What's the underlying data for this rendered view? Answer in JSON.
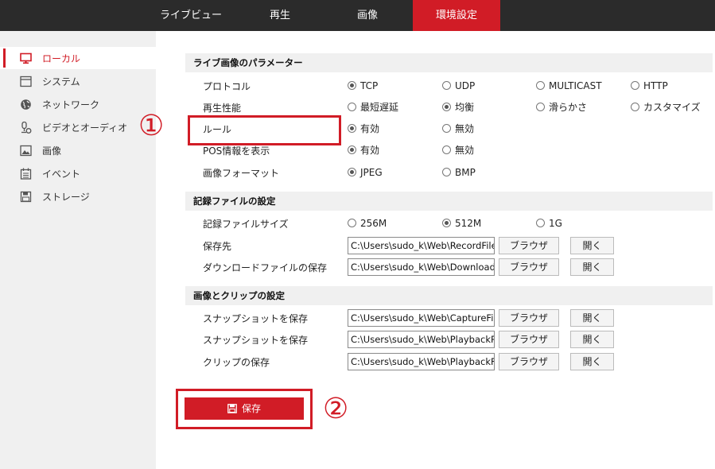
{
  "topnav": {
    "tabs": [
      {
        "label": "ライブビュー"
      },
      {
        "label": "再生"
      },
      {
        "label": "画像"
      },
      {
        "label": "環境設定",
        "active": true
      }
    ]
  },
  "sidebar": {
    "items": [
      {
        "label": "ローカル",
        "icon": "monitor-icon",
        "active": true
      },
      {
        "label": "システム",
        "icon": "system-window-icon"
      },
      {
        "label": "ネットワーク",
        "icon": "globe-icon"
      },
      {
        "label": "ビデオとオーディオ",
        "icon": "video-audio-icon"
      },
      {
        "label": "画像",
        "icon": "image-icon"
      },
      {
        "label": "イベント",
        "icon": "calendar-icon"
      },
      {
        "label": "ストレージ",
        "icon": "floppy-icon"
      }
    ]
  },
  "live_params": {
    "title": "ライブ画像のパラメーター",
    "rows": [
      {
        "label": "プロトコル",
        "options": [
          "TCP",
          "UDP",
          "MULTICAST",
          "HTTP"
        ],
        "selected": "TCP"
      },
      {
        "label": "再生性能",
        "options": [
          "最短遅延",
          "均衡",
          "滑らかさ",
          "カスタマイズ"
        ],
        "selected": "均衡"
      },
      {
        "label": "ルール",
        "options": [
          "有効",
          "無効"
        ],
        "selected": "有効"
      },
      {
        "label": "POS情報を表示",
        "options": [
          "有効",
          "無効"
        ],
        "selected": "有効"
      },
      {
        "label": "画像フォーマット",
        "options": [
          "JPEG",
          "BMP"
        ],
        "selected": "JPEG"
      }
    ]
  },
  "record_settings": {
    "title": "記録ファイルの設定",
    "size_row": {
      "label": "記録ファイルサイズ",
      "options": [
        "256M",
        "512M",
        "1G"
      ],
      "selected": "512M"
    },
    "path_rows": [
      {
        "label": "保存先",
        "value": "C:\\Users\\sudo_k\\Web\\RecordFiles",
        "browse": "ブラウザ",
        "open": "開く"
      },
      {
        "label": "ダウンロードファイルの保存",
        "value": "C:\\Users\\sudo_k\\Web\\DownloadFiles",
        "browse": "ブラウザ",
        "open": "開く"
      }
    ]
  },
  "clip_settings": {
    "title": "画像とクリップの設定",
    "path_rows": [
      {
        "label": "スナップショットを保存",
        "value": "C:\\Users\\sudo_k\\Web\\CaptureFiles",
        "browse": "ブラウザ",
        "open": "開く"
      },
      {
        "label": "スナップショットを保存",
        "value": "C:\\Users\\sudo_k\\Web\\PlaybackPics",
        "browse": "ブラウザ",
        "open": "開く"
      },
      {
        "label": "クリップの保存",
        "value": "C:\\Users\\sudo_k\\Web\\PlaybackFiles",
        "browse": "ブラウザ",
        "open": "開く"
      }
    ]
  },
  "save_button": {
    "label": "保存",
    "icon": "save-icon"
  },
  "annotations": {
    "one": "①",
    "two": "②"
  },
  "colors": {
    "accent": "#d11c26",
    "topbar": "#2b2b2b",
    "sidebar": "#f0f0f0"
  }
}
